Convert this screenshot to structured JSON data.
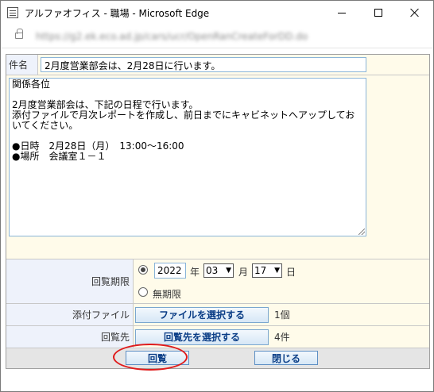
{
  "window": {
    "title": "アルファオフィス - 職場 - Microsoft Edge",
    "url": "https://g2.ek.eco.ad.jp/cars/ucr/OpenRanCreateForDD.do"
  },
  "form": {
    "subject_label": "件名",
    "subject_value": "2月度営業部会は、2月28日に行います。",
    "body_text": "関係各位\n\n2月度営業部会は、下記の日程で行います。\n添付ファイルで月次レポートを作成し、前日までにキャビネットへアップしておいてください。\n\n●日時　2月28日（月）　13:00～16:00\n●場所　会議室１－１",
    "deadline_label": "回覧期限",
    "deadline": {
      "year": "2022",
      "year_unit": "年",
      "month": "03",
      "month_unit": "月",
      "day": "17",
      "day_unit": "日",
      "no_deadline_label": "無期限",
      "dated_selected": true
    },
    "attach_label": "添付ファイル",
    "attach_button": "ファイルを選択する",
    "attach_count": "1個",
    "route_label": "回覧先",
    "route_button": "回覧先を選択する",
    "route_count": "4件"
  },
  "actions": {
    "submit_label": "回覧",
    "close_label": "閉じる"
  },
  "colors": {
    "label_bg": "#eef2fb",
    "value_bg": "#fffbea",
    "button_text": "#0a3d86",
    "highlight": "#e01b1b"
  }
}
